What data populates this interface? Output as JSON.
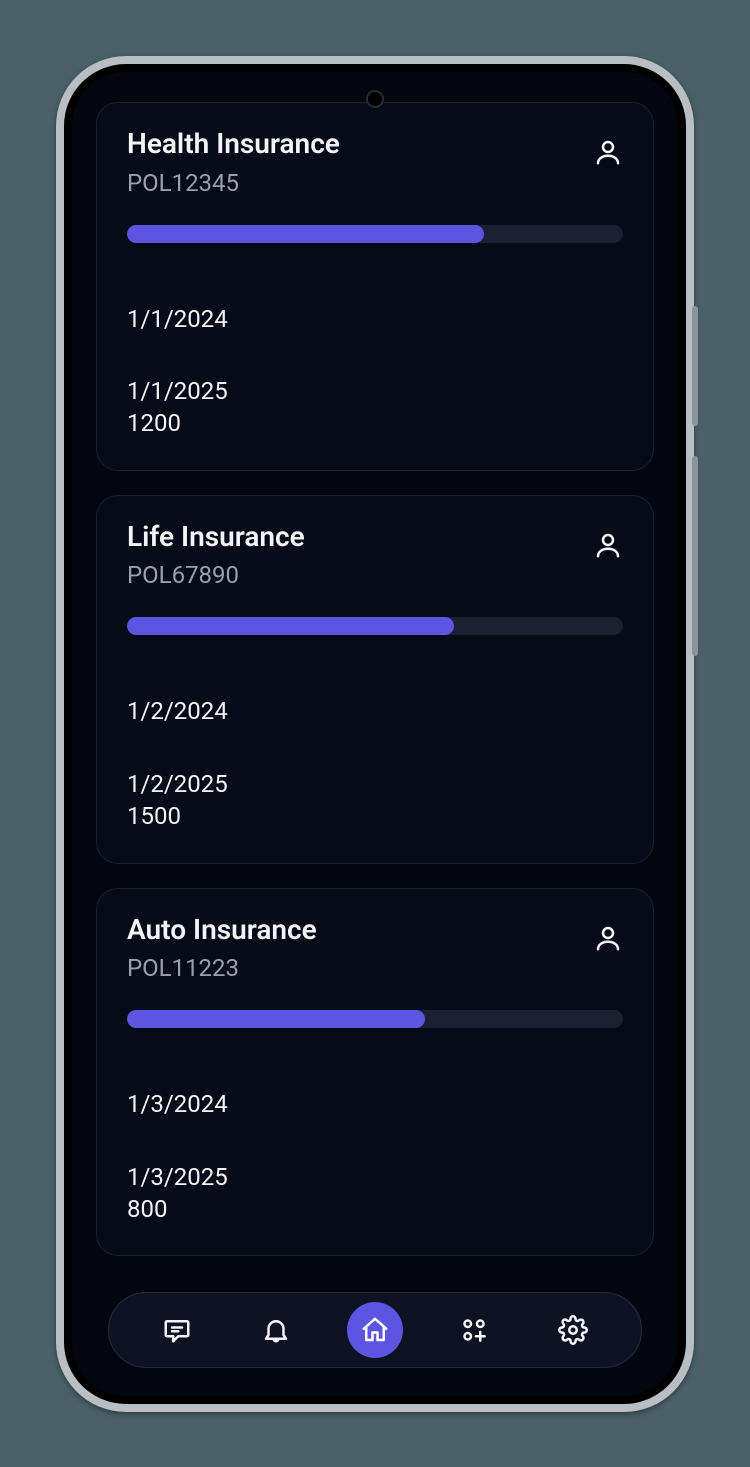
{
  "accent": "#5b55e2",
  "policies": [
    {
      "title": "Health Insurance",
      "policy_id": "POL12345",
      "progress_pct": 72,
      "start_date": "1/1/2024",
      "end_date": "1/1/2025",
      "amount": "1200"
    },
    {
      "title": "Life Insurance",
      "policy_id": "POL67890",
      "progress_pct": 66,
      "start_date": "1/2/2024",
      "end_date": "1/2/2025",
      "amount": "1500"
    },
    {
      "title": "Auto Insurance",
      "policy_id": "POL11223",
      "progress_pct": 60,
      "start_date": "1/3/2024",
      "end_date": "1/3/2025",
      "amount": "800"
    }
  ],
  "nav": {
    "items": [
      "chat",
      "notifications",
      "home",
      "apps",
      "settings"
    ],
    "active": "home"
  }
}
